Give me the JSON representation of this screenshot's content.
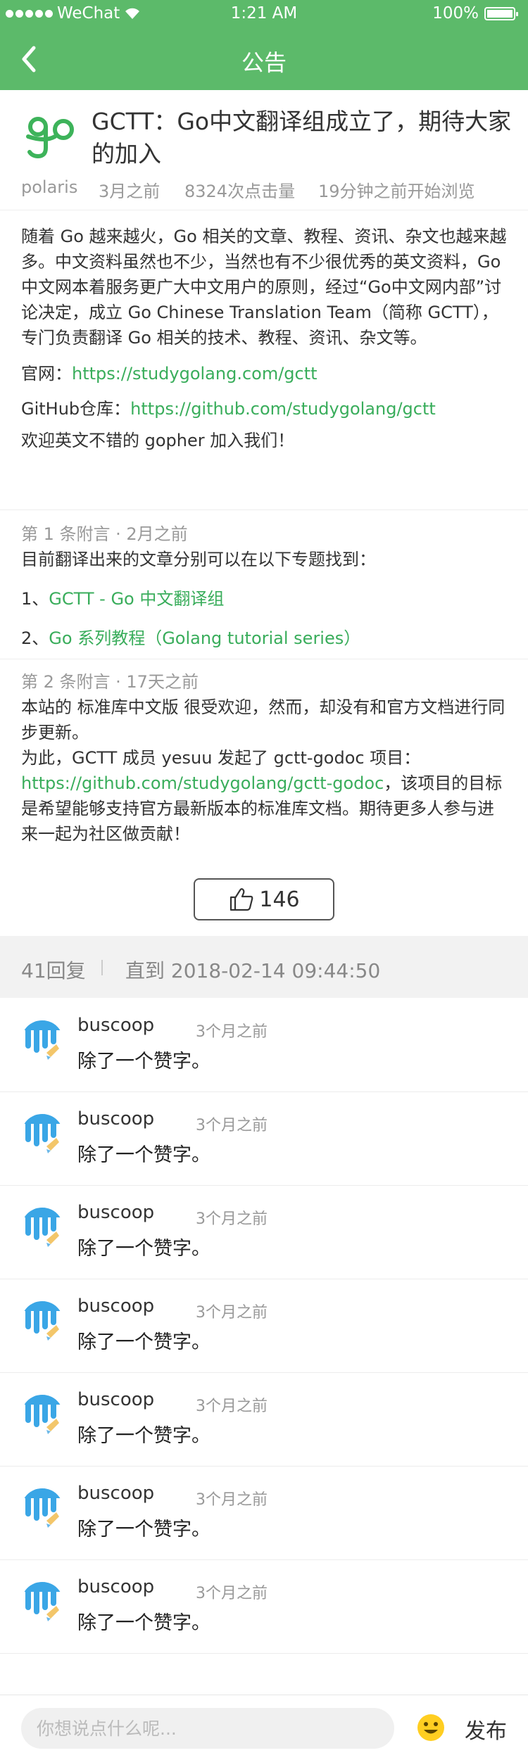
{
  "status_bar": {
    "carrier": "WeChat",
    "time": "1:21 AM",
    "battery": "100%",
    "battery_level": 1.0
  },
  "nav": {
    "title": "公告"
  },
  "post": {
    "title": "GCTT：Go中文翻译组成立了，期待大家的加入",
    "author": "polaris",
    "posted": "3月之前",
    "views": "8324次点击量",
    "browsing": "19分钟之前开始浏览",
    "body": "随着 Go 越来越火，Go 相关的文章、教程、资讯、杂文也越来越多。中文资料虽然也不少，当然也有不少很优秀的英文资料，Go 中文网本着服务更广大中文用户的原则，经过“Go中文网内部”讨论决定，成立 Go Chinese Translation Team（简称 GCTT），专门负责翻译 Go 相关的技术、教程、资讯、杂文等。",
    "official_label": "官网：",
    "official_link": "https://studygolang.com/gctt",
    "github_label": "GitHub仓库：",
    "github_link": "https://github.com/studygolang/gctt",
    "welcome": "欢迎英文不错的 gopher 加入我们！"
  },
  "appendices": [
    {
      "header": "第 1 条附言 · 2月之前",
      "intro": "目前翻译出来的文章分别可以在以下专题找到：",
      "items": [
        {
          "prefix": "1、",
          "link": "GCTT - Go 中文翻译组"
        },
        {
          "prefix": "2、",
          "link": "Go 系列教程（Golang tutorial series）"
        }
      ]
    },
    {
      "header": "第 2 条附言 · 17天之前",
      "line1": "本站的 标准库中文版 很受欢迎，然而，却没有和官方文档进行同步更新。",
      "line2": "为此，GCTT 成员 yesuu 发起了 gctt-godoc 项目：",
      "link": "https://github.com/studygolang/gctt-godoc",
      "line3": "，该项目的目标是希望能够支持官方最新版本的标准库文档。期待更多人参与进来一起为社区做贡献！"
    }
  ],
  "likes": "146",
  "replies_bar": {
    "count": "41回复",
    "until": "直到 2018-02-14  09:44:50"
  },
  "comments": [
    {
      "name": "buscoop",
      "time": "3个月之前",
      "text": "除了一个赞字。"
    },
    {
      "name": "buscoop",
      "time": "3个月之前",
      "text": "除了一个赞字。"
    },
    {
      "name": "buscoop",
      "time": "3个月之前",
      "text": "除了一个赞字。"
    },
    {
      "name": "buscoop",
      "time": "3个月之前",
      "text": "除了一个赞字。"
    },
    {
      "name": "buscoop",
      "time": "3个月之前",
      "text": "除了一个赞字。"
    },
    {
      "name": "buscoop",
      "time": "3个月之前",
      "text": "除了一个赞字。"
    },
    {
      "name": "buscoop",
      "time": "3个月之前",
      "text": "除了一个赞字。"
    }
  ],
  "input": {
    "placeholder": "你想说点什么呢...",
    "value": "",
    "publish_label": "发布"
  },
  "colors": {
    "accent": "#5cba6a",
    "link": "#39ad5b"
  },
  "icons": [
    "wifi-icon",
    "battery-icon",
    "back-icon",
    "go-logo",
    "thumbs-up-icon",
    "avatar-icon",
    "emoji-icon"
  ]
}
